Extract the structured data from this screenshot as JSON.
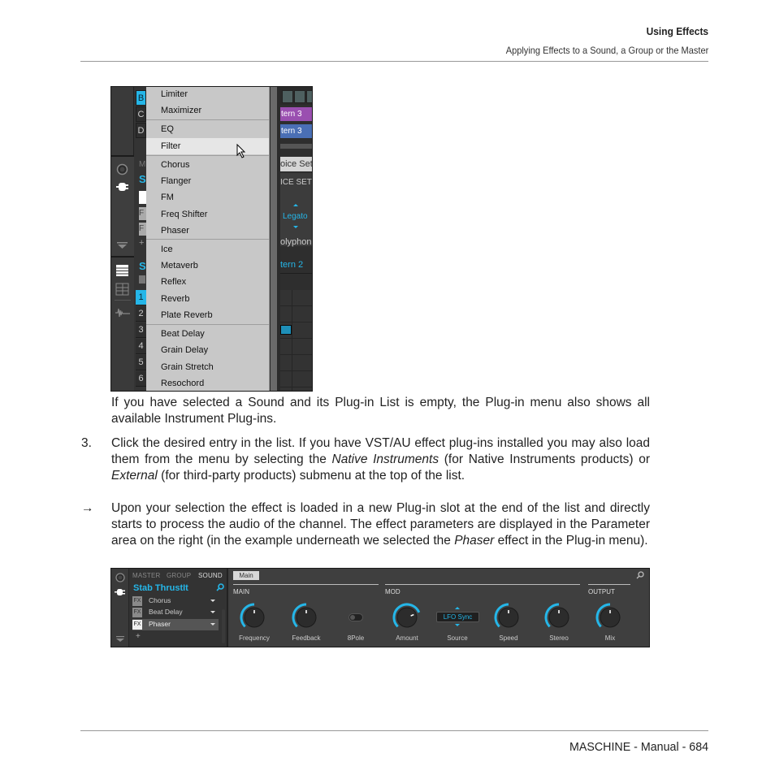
{
  "header": {
    "chapter": "Using Effects",
    "section": "Applying Effects to a Sound, a Group or the Master"
  },
  "footer": {
    "text": "MASCHINE - Manual - 684"
  },
  "plugin_menu_screenshot": {
    "group_letters": [
      "B",
      "C",
      "D"
    ],
    "selected_group": "B",
    "pad_numbers": [
      "1",
      "2",
      "3",
      "4",
      "5",
      "6"
    ],
    "selected_pad": "1",
    "left_panel_fragments": {
      "master_tab_initial": "M",
      "sound_initial": "S",
      "sound_initial_2": "S",
      "fx_fragment": "F",
      "plus": "+"
    },
    "menu_groups": [
      [
        "Limiter",
        "Maximizer"
      ],
      [
        "EQ",
        "Filter"
      ],
      [
        "Chorus",
        "Flanger",
        "FM",
        "Freq Shifter",
        "Phaser"
      ],
      [
        "Ice",
        "Metaverb",
        "Reflex",
        "Reverb",
        "Plate Reverb"
      ],
      [
        "Beat Delay",
        "Grain Delay",
        "Grain Stretch",
        "Resochord"
      ]
    ],
    "menu_items": [
      "Limiter",
      "Maximizer",
      "EQ",
      "Filter",
      "Chorus",
      "Flanger",
      "FM",
      "Freq Shifter",
      "Phaser",
      "Ice",
      "Metaverb",
      "Reflex",
      "Reverb",
      "Plate Reverb",
      "Beat Delay",
      "Grain Delay",
      "Grain Stretch",
      "Resochord"
    ],
    "hovered_item": "Filter",
    "right_panel_fragments": {
      "pattern_1": "tern 3",
      "pattern_2": "tern 3",
      "voice_settings": "oice Set",
      "voice_settings_header": "ICE SET",
      "legato": "Legato",
      "polyphony": "olyphon",
      "pattern_3": "tern 2"
    },
    "colors": {
      "accent": "#25b6e8",
      "pattern_purple": "#9a4fb0",
      "pattern_blue": "#4a6fb5",
      "menu_bg": "#c8c8c8",
      "menu_highlight": "#e6e6e6"
    }
  },
  "paragraphs": {
    "p1": "If you have selected a Sound and its Plug-in List is empty, the Plug-in menu also shows all available Instrument Plug-ins.",
    "step3_number": "3.",
    "step3_a": "Click the desired entry in the list. If you have VST/AU effect plug-ins installed you may also load them from the menu by selecting the ",
    "step3_native": "Native Instruments",
    "step3_b": " (for Native Instruments products) or ",
    "step3_external": "External",
    "step3_c": " (for third-party products) submenu at the top of the list.",
    "result_arrow": "→",
    "result_a": "Upon your selection the effect is loaded in a new Plug-in slot at the end of the list and directly starts to process the audio of the channel. The effect parameters are displayed in the Parameter area on the right (in the example underneath we selected the ",
    "result_phaser": "Phaser",
    "result_b": " effect in the Plug-in menu)."
  },
  "parameter_screenshot": {
    "tabs": [
      "MASTER",
      "GROUP",
      "SOUND"
    ],
    "active_tab": "SOUND",
    "sound_name": "Stab ThrustIt",
    "plugin_slots": [
      {
        "badge": "FX",
        "name": "Chorus",
        "selected": false
      },
      {
        "badge": "FX",
        "name": "Beat Delay",
        "selected": false
      },
      {
        "badge": "FX",
        "name": "Phaser",
        "selected": true
      }
    ],
    "add_slot": "+",
    "page_tab": "Main",
    "groups": [
      {
        "label": "MAIN"
      },
      {
        "label": "MOD"
      },
      {
        "label": "OUTPUT"
      }
    ],
    "parameters": [
      {
        "label": "Frequency",
        "type": "knob",
        "value": 0.5
      },
      {
        "label": "Feedback",
        "type": "knob",
        "value": 0.5
      },
      {
        "label": "8Pole",
        "type": "switch",
        "value": "off"
      },
      {
        "label": "Amount",
        "type": "knob",
        "value": 0.75
      },
      {
        "label": "Source",
        "type": "selector",
        "value": "LFO Sync"
      },
      {
        "label": "Speed",
        "type": "knob",
        "value": 0.5
      },
      {
        "label": "Stereo",
        "type": "knob",
        "value": 0.5
      },
      {
        "label": "Mix",
        "type": "knob",
        "value": 0.5
      }
    ],
    "colors": {
      "accent": "#25b6e8",
      "panel_bg": "#3f3f3f"
    }
  }
}
